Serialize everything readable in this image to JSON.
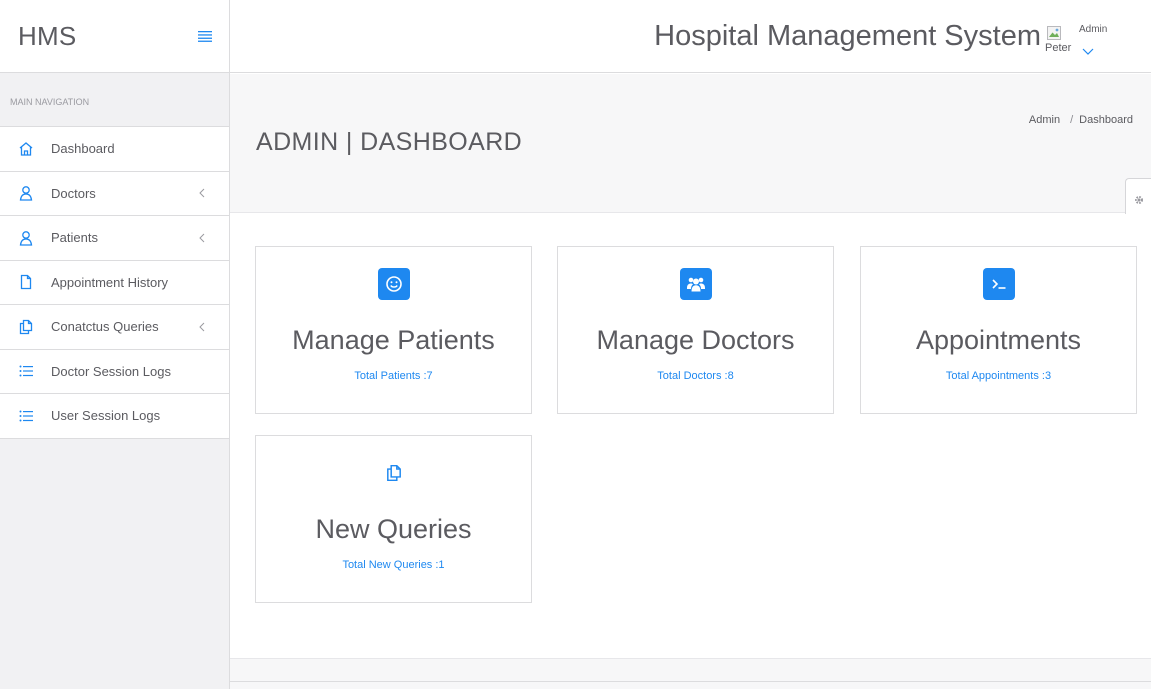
{
  "brand": {
    "name": "HMS"
  },
  "sidebar": {
    "header": "MAIN NAVIGATION",
    "items": [
      {
        "label": "Dashboard",
        "icon": "home-icon",
        "has_submenu": false
      },
      {
        "label": "Doctors",
        "icon": "user-icon",
        "has_submenu": true
      },
      {
        "label": "Patients",
        "icon": "user-icon",
        "has_submenu": true
      },
      {
        "label": "Appointment History",
        "icon": "file-icon",
        "has_submenu": false
      },
      {
        "label": "Conatctus Queries",
        "icon": "files-icon",
        "has_submenu": true
      },
      {
        "label": "Doctor Session Logs",
        "icon": "list-icon",
        "has_submenu": false
      },
      {
        "label": "User Session Logs",
        "icon": "list-icon",
        "has_submenu": false
      }
    ]
  },
  "topbar": {
    "title": "Hospital Management System",
    "user": {
      "name": "Peter",
      "role": "Admin"
    }
  },
  "page": {
    "title": "ADMIN | DASHBOARD",
    "breadcrumb": [
      "Admin",
      "Dashboard"
    ],
    "breadcrumb_separator": "/"
  },
  "cards": [
    {
      "title": "Manage Patients",
      "subtitle": "Total Patients :7",
      "icon": "smiley-icon"
    },
    {
      "title": "Manage Doctors",
      "subtitle": "Total Doctors :8",
      "icon": "users-icon"
    },
    {
      "title": "Appointments",
      "subtitle": "Total Appointments :3",
      "icon": "terminal-icon"
    },
    {
      "title": "New Queries",
      "subtitle": "Total New Queries :1",
      "icon": "files-icon"
    }
  ],
  "colors": {
    "accent": "#1e88f0",
    "text": "#5b5b60",
    "sidebar_bg": "#f1f1f3",
    "border": "#dcdcde"
  }
}
